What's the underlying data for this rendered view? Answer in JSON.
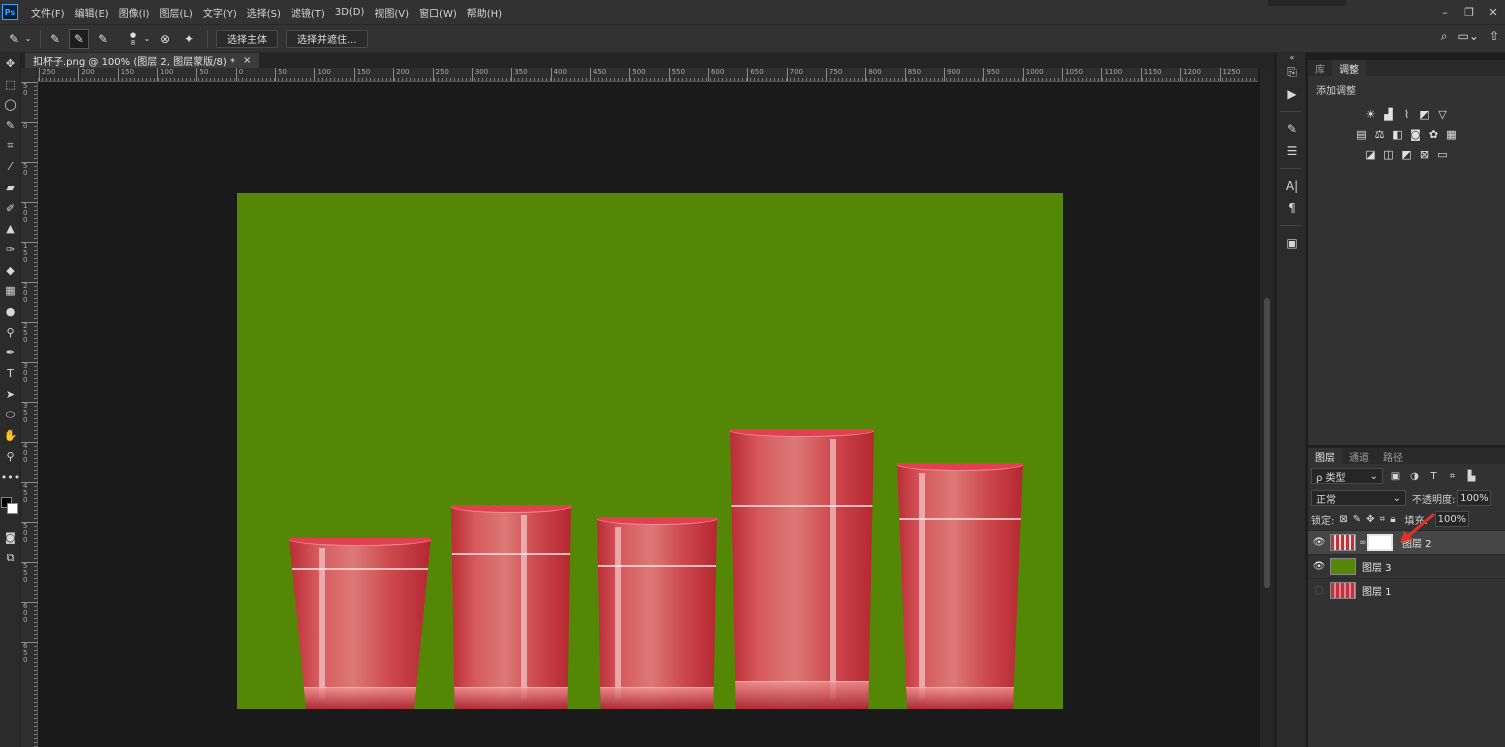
{
  "menubar": {
    "logo": "Ps",
    "items": [
      "文件(F)",
      "编辑(E)",
      "图像(I)",
      "图层(L)",
      "文字(Y)",
      "选择(S)",
      "滤镜(T)",
      "3D(D)",
      "视图(V)",
      "窗口(W)",
      "帮助(H)"
    ],
    "window_controls": [
      "minimize-icon",
      "restore-icon",
      "close-icon"
    ]
  },
  "options": {
    "brush_size": "8",
    "select_subject": "选择主体",
    "select_and_mask": "选择并遮住..."
  },
  "document": {
    "tab_title": "扣杯子.png @ 100% (图层 2, 图层蒙版/8) *",
    "close": "×",
    "ruler_top_labels": [
      "250",
      "200",
      "150",
      "100",
      "50",
      "0",
      "50",
      "100",
      "150",
      "200",
      "250",
      "300",
      "350",
      "400",
      "450",
      "500",
      "550",
      "600",
      "650",
      "700",
      "750",
      "800",
      "850",
      "900",
      "950",
      "1000",
      "1050",
      "1100",
      "1150",
      "1200",
      "1250"
    ],
    "ruler_left_labels": [
      "50",
      "0",
      "50",
      "100",
      "150",
      "200",
      "250",
      "300",
      "350",
      "400",
      "450",
      "500",
      "550",
      "600",
      "650"
    ],
    "canvas_color": "#548706"
  },
  "adjust_panel": {
    "tabs": [
      "库",
      "调整"
    ],
    "active_tab": "调整",
    "title": "添加调整"
  },
  "layers_panel": {
    "tabs": [
      "图层",
      "通道",
      "路径"
    ],
    "filter_label": "ρ 类型",
    "blend_mode": "正常",
    "opacity_label": "不透明度:",
    "opacity_value": "100%",
    "lock_label": "锁定:",
    "fill_label": "填充:",
    "fill_value": "100%",
    "layers": [
      {
        "name": "图层 2",
        "visible": true,
        "selected": true,
        "has_mask": true
      },
      {
        "name": "图层 3",
        "visible": true,
        "selected": false,
        "has_mask": false
      },
      {
        "name": "图层 1",
        "visible": false,
        "selected": false,
        "has_mask": false
      }
    ]
  },
  "colors": {
    "accent": "#31a8ff",
    "canvas_green": "#548706",
    "annotation_arrow": "#e0302a"
  }
}
